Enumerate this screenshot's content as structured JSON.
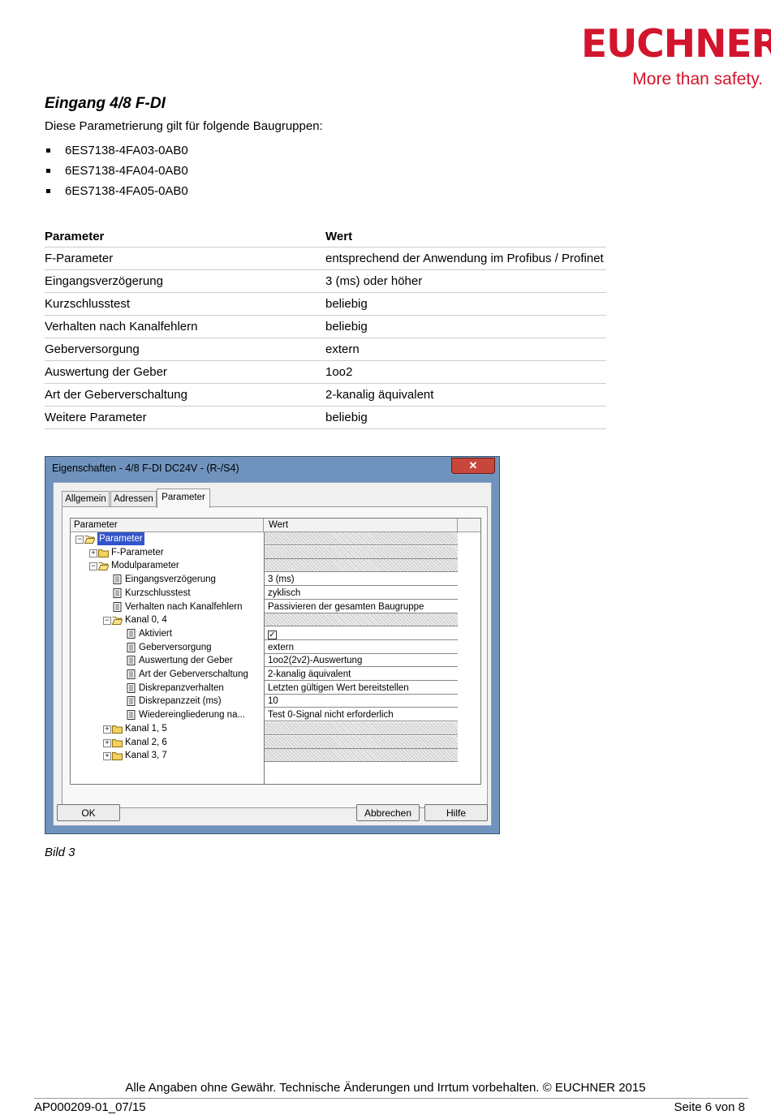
{
  "brand": {
    "name": "EUCHNER",
    "slogan": "More than safety.",
    "color": "#d2142c"
  },
  "title": "Eingang 4/8 F-DI",
  "intro": "Diese Parametrierung gilt für folgende Baugruppen:",
  "modules": [
    "6ES7138-4FA03-0AB0",
    "6ES7138-4FA04-0AB0",
    "6ES7138-4FA05-0AB0"
  ],
  "param_table": {
    "headers": [
      "Parameter",
      "Wert"
    ],
    "rows": [
      [
        "F-Parameter",
        "entsprechend der Anwendung im Profibus / Profinet"
      ],
      [
        "Eingangsverzögerung",
        "3 (ms) oder höher"
      ],
      [
        "Kurzschlusstest",
        "beliebig"
      ],
      [
        "Verhalten nach Kanalfehlern",
        "beliebig"
      ],
      [
        "Geberversorgung",
        "extern"
      ],
      [
        "Auswertung der Geber",
        "1oo2"
      ],
      [
        "Art der Geberverschaltung",
        "2-kanalig äquivalent"
      ],
      [
        "Weitere Parameter",
        "beliebig"
      ]
    ]
  },
  "dialog": {
    "title": "Eigenschaften - 4/8 F-DI DC24V - (R-/S4)",
    "close_label": "✕",
    "tabs": [
      "Allgemein",
      "Adressen",
      "Parameter"
    ],
    "active_tab": "Parameter",
    "grid_headers": [
      "Parameter",
      "Wert"
    ],
    "tree": [
      {
        "label": "Parameter",
        "value": "",
        "level": 0,
        "icon": "folder-open-icon",
        "expander": "−",
        "selected": true
      },
      {
        "label": "F-Parameter",
        "value": "",
        "level": 1,
        "icon": "folder-icon",
        "expander": "+"
      },
      {
        "label": "Modulparameter",
        "value": "",
        "level": 1,
        "icon": "folder-open-icon",
        "expander": "−"
      },
      {
        "label": "Eingangsverzögerung",
        "value": "3 (ms)",
        "level": 2,
        "icon": "document-icon"
      },
      {
        "label": "Kurzschlusstest",
        "value": "zyklisch",
        "level": 2,
        "icon": "document-icon"
      },
      {
        "label": "Verhalten nach Kanalfehlern",
        "value": "Passivieren der gesamten Baugruppe",
        "level": 2,
        "icon": "document-icon"
      },
      {
        "label": "Kanal 0, 4",
        "value": "",
        "level": 2,
        "icon": "folder-open-icon",
        "expander": "−"
      },
      {
        "label": "Aktiviert",
        "value": "",
        "checkbox": "✓",
        "level": 3,
        "icon": "document-icon"
      },
      {
        "label": "Geberversorgung",
        "value": "extern",
        "level": 3,
        "icon": "document-icon"
      },
      {
        "label": "Auswertung der Geber",
        "value": "1oo2(2v2)-Auswertung",
        "level": 3,
        "icon": "document-icon"
      },
      {
        "label": "Art der Geberverschaltung",
        "value": "2-kanalig äquivalent",
        "level": 3,
        "icon": "document-icon"
      },
      {
        "label": "Diskrepanzverhalten",
        "value": "Letzten gültigen Wert bereitstellen",
        "level": 3,
        "icon": "document-icon"
      },
      {
        "label": "Diskrepanzzeit (ms)",
        "value": "10",
        "level": 3,
        "icon": "document-icon"
      },
      {
        "label": "Wiedereingliederung na...",
        "value": "Test 0-Signal nicht erforderlich",
        "level": 3,
        "icon": "document-icon"
      },
      {
        "label": "Kanal 1, 5",
        "value": "",
        "level": 2,
        "icon": "folder-icon",
        "expander": "+"
      },
      {
        "label": "Kanal 2, 6",
        "value": "",
        "level": 2,
        "icon": "folder-icon",
        "expander": "+"
      },
      {
        "label": "Kanal 3, 7",
        "value": "",
        "level": 2,
        "icon": "folder-icon",
        "expander": "+"
      }
    ],
    "buttons": {
      "ok": "OK",
      "cancel": "Abbrechen",
      "help": "Hilfe"
    }
  },
  "caption": "Bild 3",
  "footer": {
    "disclaimer": "Alle Angaben ohne Gewähr. Technische Änderungen und Irrtum vorbehalten. © EUCHNER 2015",
    "doc_id": "AP000209-01_07/15",
    "page": "Seite 6 von 8"
  }
}
